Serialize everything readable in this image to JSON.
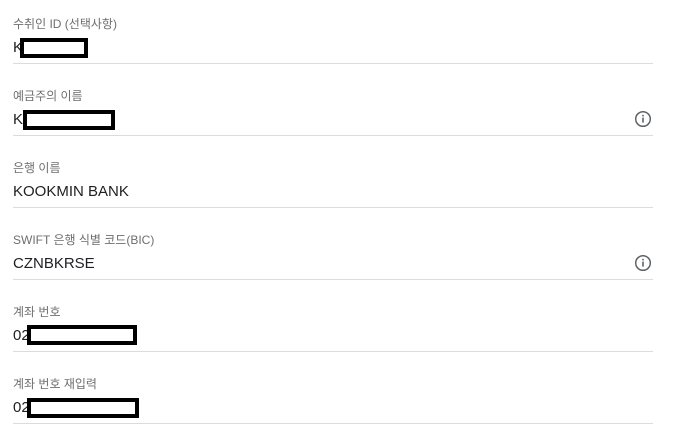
{
  "form": {
    "fields": [
      {
        "label": "수취인 ID (선택사항)",
        "value": "K",
        "redacted": true,
        "info_icon": false
      },
      {
        "label": "예금주의 이름",
        "value": "K",
        "redacted": true,
        "info_icon": "info-icon"
      },
      {
        "label": "은행 이름",
        "value": "KOOKMIN BANK",
        "redacted": false,
        "info_icon": false
      },
      {
        "label": "SWIFT 은행 식별 코드(BIC)",
        "value": "CZNBKRSE",
        "redacted": false,
        "info_icon": "info-icon"
      },
      {
        "label": "계좌 번호",
        "value": "02",
        "redacted": true,
        "info_icon": false
      },
      {
        "label": "계좌 번호 재입력",
        "value": "02",
        "redacted": true,
        "info_icon": false
      }
    ]
  },
  "colors": {
    "label": "#6e6e6e",
    "value": "#202124",
    "divider": "#dadce0",
    "icon": "#5f6368",
    "redaction": "#000000"
  }
}
